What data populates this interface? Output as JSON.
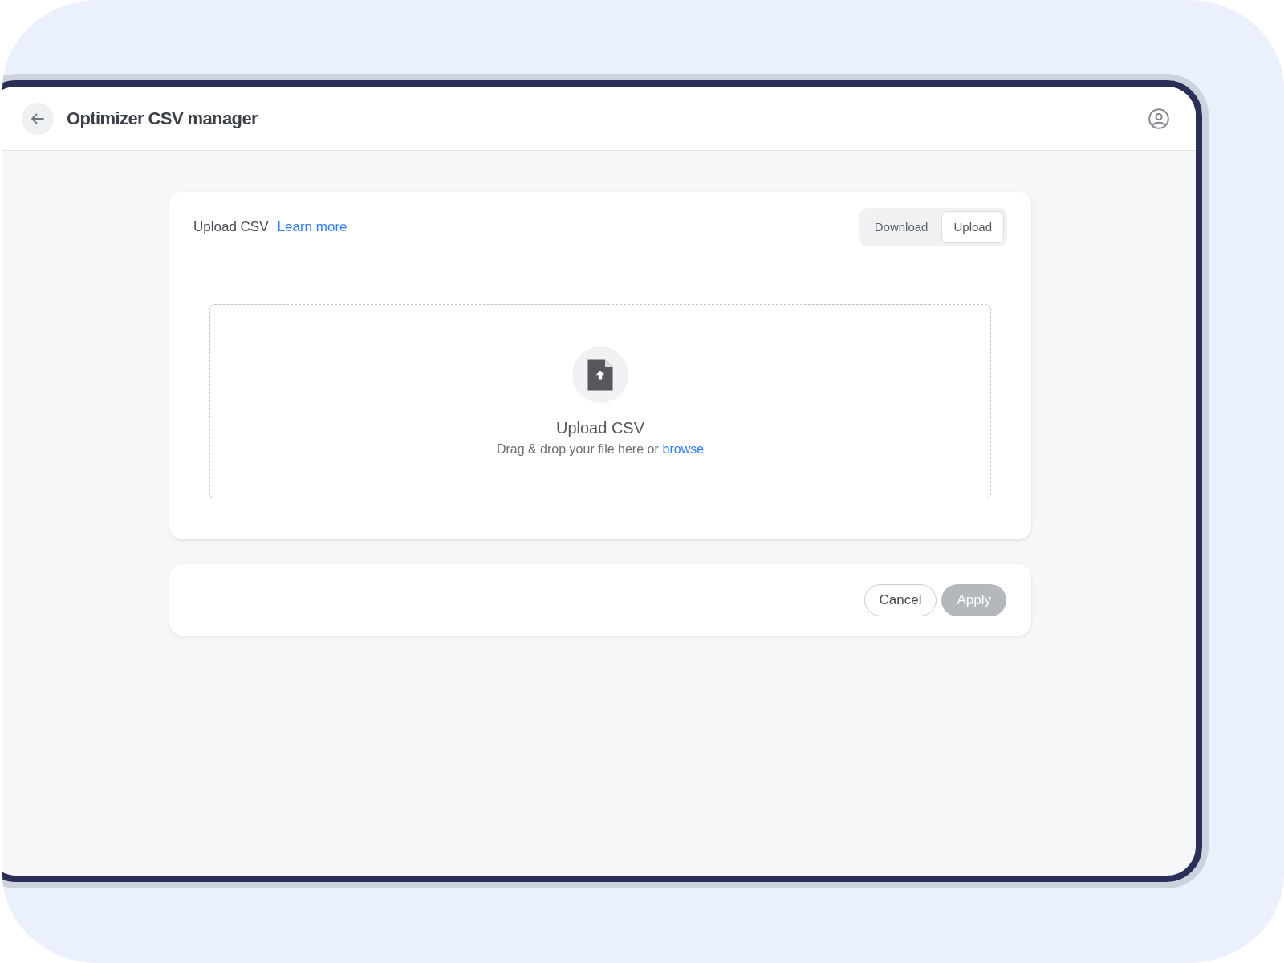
{
  "header": {
    "title": "Optimizer CSV manager"
  },
  "upload_card": {
    "title": "Upload CSV",
    "link": "Learn more",
    "tabs": [
      {
        "label": "Download",
        "selected": false
      },
      {
        "label": "Upload",
        "selected": true
      }
    ],
    "dropzone": {
      "title": "Upload CSV",
      "text": "Drag & drop your file here or",
      "link": "browse"
    }
  },
  "actions": [
    {
      "label": "Cancel",
      "kind": "secondary",
      "disabled": false
    },
    {
      "label": "Apply",
      "kind": "primary",
      "disabled": true
    }
  ]
}
